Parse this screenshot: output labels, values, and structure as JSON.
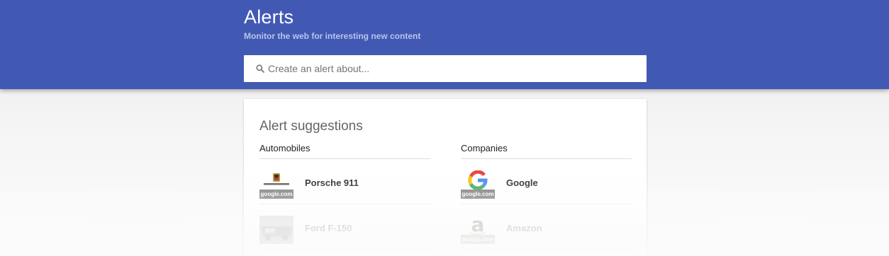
{
  "header": {
    "title": "Alerts",
    "subtitle": "Monitor the web for interesting new content",
    "background_color": "#4259b4"
  },
  "search": {
    "icon": "search-icon",
    "placeholder": "Create an alert about...",
    "value": ""
  },
  "suggestions": {
    "title": "Alert suggestions",
    "columns": [
      {
        "heading": "Automobiles",
        "items": [
          {
            "label": "Porsche 911",
            "thumb_icon": "porsche-logo-icon",
            "thumb_source": "google.com",
            "faded": false
          },
          {
            "label": "Ford F-150",
            "thumb_icon": "ford-truck-photo-icon",
            "thumb_source": "",
            "faded": true
          }
        ]
      },
      {
        "heading": "Companies",
        "items": [
          {
            "label": "Google",
            "thumb_icon": "google-logo-icon",
            "thumb_source": "google.com",
            "faded": false
          },
          {
            "label": "Amazon",
            "thumb_icon": "amazon-logo-icon",
            "thumb_source": "google.com",
            "faded": true
          }
        ]
      }
    ]
  }
}
